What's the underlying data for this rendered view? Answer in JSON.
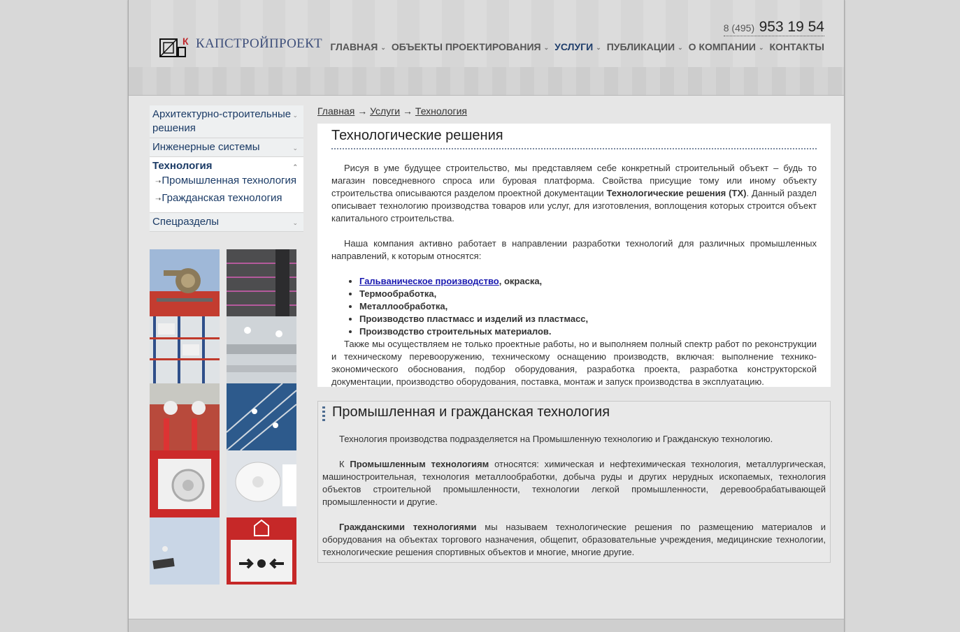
{
  "header": {
    "logo_text": "КАПСТРОЙПРОЕКТ",
    "phone_code": "8 (495)",
    "phone_number": "953 19 54"
  },
  "nav": [
    {
      "label": "ГЛАВНАЯ",
      "has_menu": true
    },
    {
      "label": "ОБЪЕКТЫ ПРОЕКТИРОВАНИЯ",
      "has_menu": true
    },
    {
      "label": "УСЛУГИ",
      "has_menu": true,
      "active": true
    },
    {
      "label": "ПУБЛИКАЦИИ",
      "has_menu": true
    },
    {
      "label": "О КОМПАНИИ",
      "has_menu": true
    },
    {
      "label": "КОНТАКТЫ",
      "has_menu": false
    }
  ],
  "sidebar": {
    "items": [
      {
        "label": "Архитектурно-строительные решения"
      },
      {
        "label": "Инженерные системы"
      },
      {
        "label": "Технология"
      },
      {
        "label": "Спецразделы"
      }
    ],
    "sub_items": [
      {
        "label": "Промышленная технология"
      },
      {
        "label": "Гражданская технология"
      }
    ]
  },
  "breadcrumb": {
    "home": "Главная",
    "sep": "→",
    "services": "Услуги",
    "current": "Технология"
  },
  "main": {
    "title": "Технологические решения",
    "p1_a": "Рисуя в уме будущее строительство, мы представляем себе конкретный строительный объект – будь то магазин повседневного спроса или буровая платформа. Свойства присущие тому или иному объекту строительства описываются разделом проектной документации ",
    "p1_bold": "Технологические решения (ТХ)",
    "p1_b": ". Данный раздел описывает технологию производства товаров или услуг, для изготовления, воплощения которых строится объект капитального строительства.",
    "p2": "Наша компания активно работает в направлении разработки технологий для различных промышленных направлений, к которым относятся:",
    "list_link": "Гальваническое производство",
    "list_link_rest": ", окраска,",
    "list": [
      "Термообработка,",
      "Металлообработка,",
      "Производство пластмасс и изделий из пластмасс,",
      "Производство строительных материалов."
    ],
    "p3": "Также мы осуществляем не только проектные работы, но и выполняем полный спектр работ по реконструкции и техническому перевооружению, техническому оснащению производств, включая: выполнение технико-экономического обоснования, подбор оборудования, разработка проекта, разработка конструкторской документации, производство оборудования, поставка, монтаж и запуск производства в эксплуатацию."
  },
  "section2": {
    "title": "Промышленная и гражданская технология",
    "p1": "Технология производства подразделяется на Промышленную технологию и Гражданскую технологию.",
    "p2_pre": "К ",
    "p2_bold": "Промышленным технологиям",
    "p2_rest": " относятся: химическая и нефтехимическая технология, металлургическая, машиностроительная, технология металлообработки, добыча руды и других нерудных ископаемых, технология объектов строительной промышленности, технологии легкой промышленности, деревообрабатывающей промышленности и другие.",
    "p3_bold": "Гражданскими технологиями",
    "p3_rest": " мы называем технологические решения по размещению материалов и оборудования на объектах торгового назначения, общепит, образовательные учреждения, медицинские технологии, технологические решения спортивных объектов и многие, многие другие."
  },
  "colors": {
    "nav_active": "#1e3d6b",
    "link": "#1a1ab0",
    "sidebar_text": "#1b3b66"
  }
}
